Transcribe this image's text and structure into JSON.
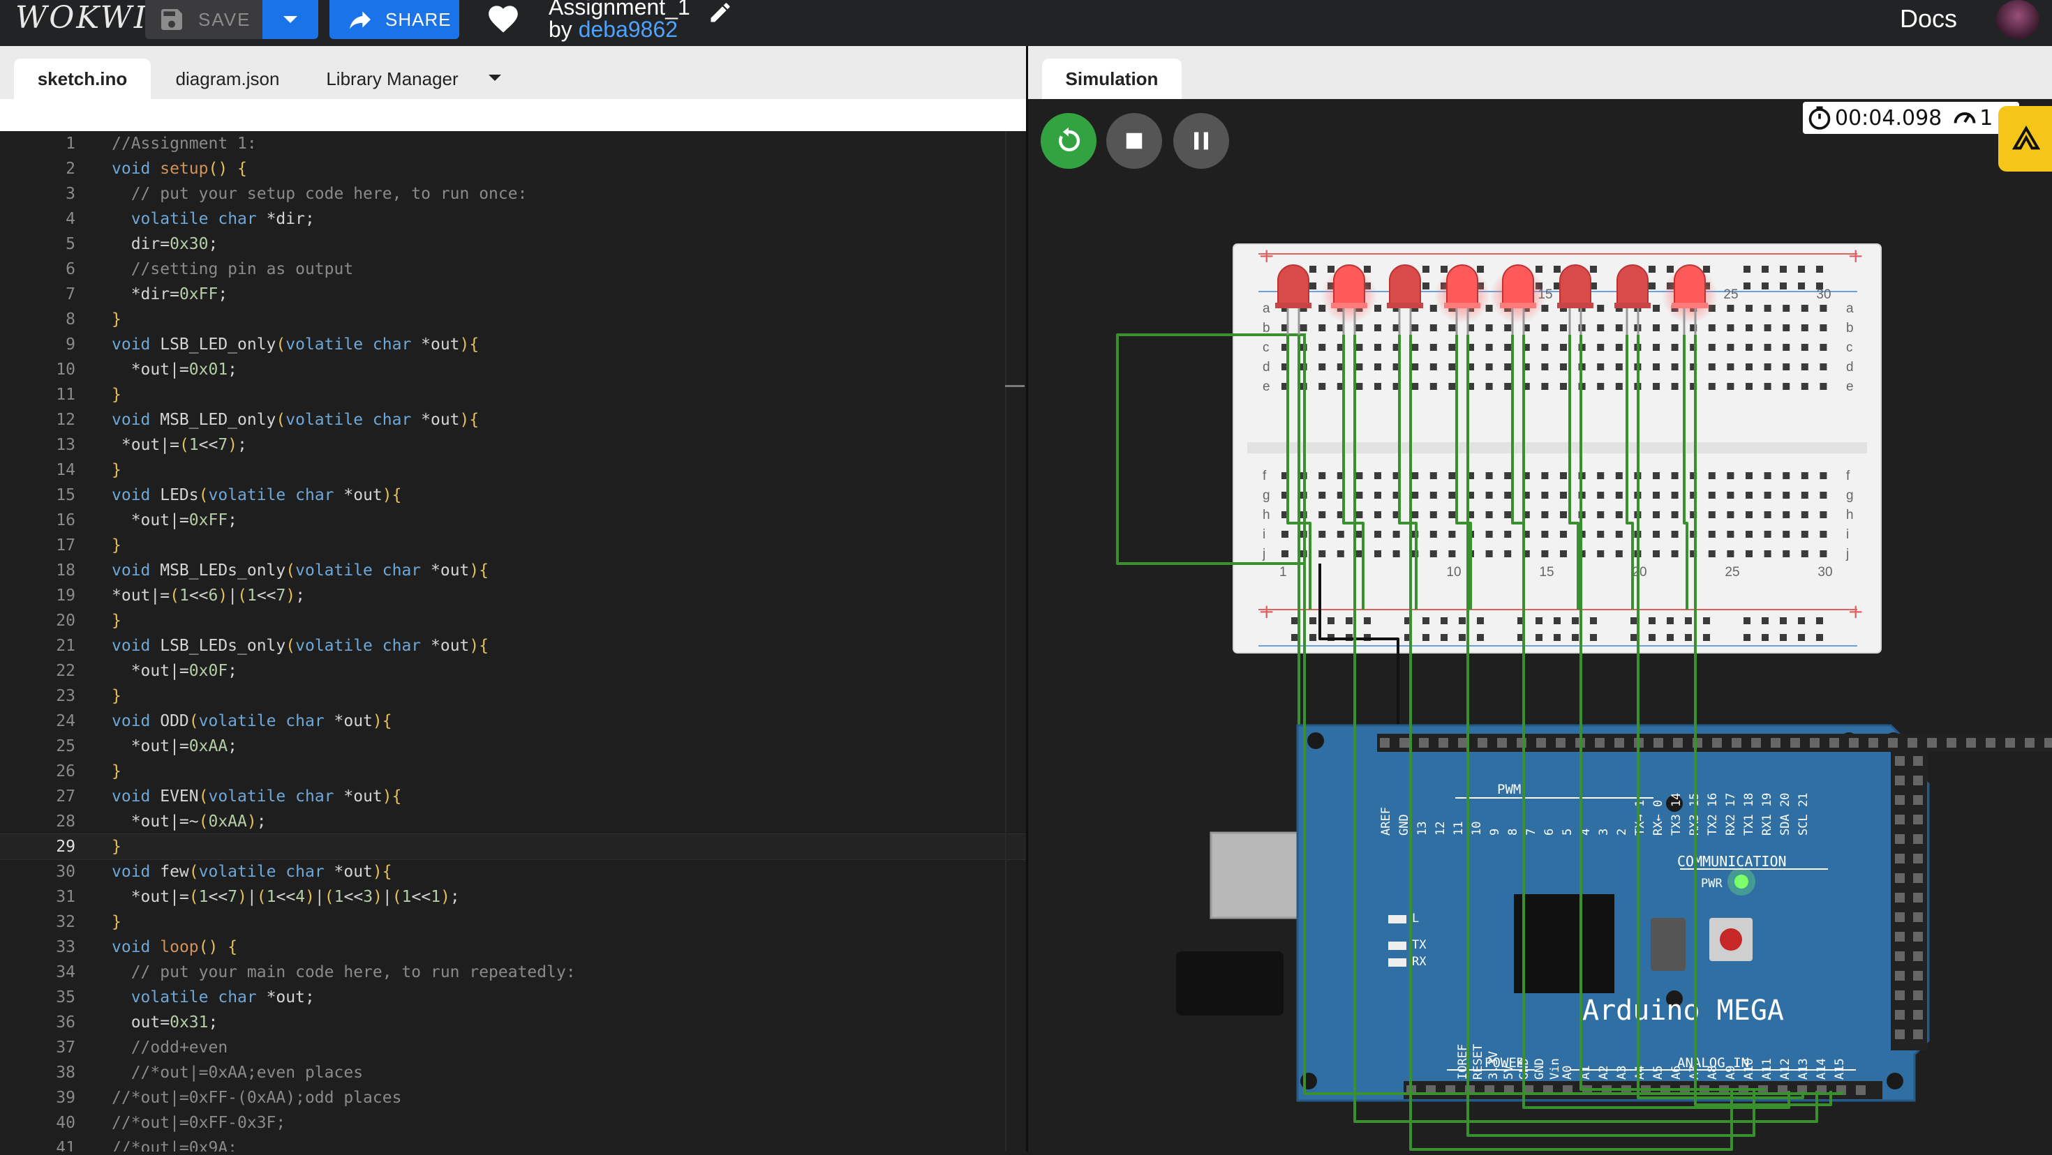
{
  "app": {
    "logo": "WOKWI",
    "docs_label": "Docs"
  },
  "toolbar": {
    "save_label": "SAVE",
    "share_label": "SHARE"
  },
  "project": {
    "title": "Assignment_1",
    "by_prefix": "by ",
    "author": "deba9862"
  },
  "editor": {
    "tabs": [
      "sketch.ino",
      "diagram.json",
      "Library Manager"
    ],
    "active_tab": "sketch.ino",
    "current_line": 29,
    "lines": [
      {
        "n": "1",
        "t": "//Assignment 1:"
      },
      {
        "n": "2",
        "t": "void setup() {"
      },
      {
        "n": "3",
        "t": "  // put your setup code here, to run once:"
      },
      {
        "n": "4",
        "t": "  volatile char *dir;"
      },
      {
        "n": "5",
        "t": "  dir=0x30;"
      },
      {
        "n": "6",
        "t": "  //setting pin as output"
      },
      {
        "n": "7",
        "t": "  *dir=0xFF;"
      },
      {
        "n": "8",
        "t": "}"
      },
      {
        "n": "9",
        "t": "void LSB_LED_only(volatile char *out){"
      },
      {
        "n": "10",
        "t": "  *out|=0x01;"
      },
      {
        "n": "11",
        "t": "}"
      },
      {
        "n": "12",
        "t": "void MSB_LED_only(volatile char *out){"
      },
      {
        "n": "13",
        "t": " *out|=(1<<7);"
      },
      {
        "n": "14",
        "t": "}"
      },
      {
        "n": "15",
        "t": "void LEDs(volatile char *out){"
      },
      {
        "n": "16",
        "t": "  *out|=0xFF;"
      },
      {
        "n": "17",
        "t": "}"
      },
      {
        "n": "18",
        "t": "void MSB_LEDs_only(volatile char *out){"
      },
      {
        "n": "19",
        "t": "*out|=(1<<6)|(1<<7);"
      },
      {
        "n": "20",
        "t": "}"
      },
      {
        "n": "21",
        "t": "void LSB_LEDs_only(volatile char *out){"
      },
      {
        "n": "22",
        "t": "  *out|=0x0F;"
      },
      {
        "n": "23",
        "t": "}"
      },
      {
        "n": "24",
        "t": "void ODD(volatile char *out){"
      },
      {
        "n": "25",
        "t": "  *out|=0xAA;"
      },
      {
        "n": "26",
        "t": "}"
      },
      {
        "n": "27",
        "t": "void EVEN(volatile char *out){"
      },
      {
        "n": "28",
        "t": "  *out|=~(0xAA);"
      },
      {
        "n": "29",
        "t": "}"
      },
      {
        "n": "30",
        "t": "void few(volatile char *out){"
      },
      {
        "n": "31",
        "t": "  *out|=(1<<7)|(1<<4)|(1<<3)|(1<<1);"
      },
      {
        "n": "32",
        "t": "}"
      },
      {
        "n": "33",
        "t": "void loop() {"
      },
      {
        "n": "34",
        "t": "  // put your main code here, to run repeatedly:"
      },
      {
        "n": "35",
        "t": "  volatile char *out;"
      },
      {
        "n": "36",
        "t": "  out=0x31;"
      },
      {
        "n": "37",
        "t": "  //odd+even"
      },
      {
        "n": "38",
        "t": "  //*out|=0xAA;even places"
      },
      {
        "n": "39",
        "t": "//*out|=0xFF-(0xAA);odd places"
      },
      {
        "n": "40",
        "t": "//*out|=0xFF-0x3F;"
      },
      {
        "n": "41",
        "t": "//*out|=0x9A;"
      }
    ]
  },
  "simulation": {
    "tab_label": "Simulation",
    "timer": "00:04.098",
    "speed_partial": "1",
    "breadboard": {
      "top_numbers": [
        "15",
        "0",
        "25",
        "30"
      ],
      "bottom_numbers": [
        "1",
        "10",
        "15",
        "20",
        "25",
        "30"
      ],
      "row_letters_top": [
        "a",
        "b",
        "c",
        "d",
        "e"
      ],
      "row_letters_bottom": [
        "f",
        "g",
        "h",
        "i",
        "j"
      ]
    },
    "leds_lit": [
      false,
      true,
      false,
      true,
      true,
      false,
      false,
      true
    ],
    "arduino": {
      "name": "Arduino MEGA",
      "labels": {
        "pwm": "PWM",
        "communication": "COMMUNICATION",
        "power": "POWER",
        "analog_in": "ANALOG IN",
        "l": "L",
        "tx": "TX",
        "rx": "RX",
        "pwr": "PWR"
      },
      "top_pins": [
        "AREF",
        "GND",
        "13",
        "12",
        "11",
        "10",
        "9",
        "8",
        "7",
        "6",
        "5",
        "4",
        "3",
        "2",
        "TX→ 1",
        "RX← 0",
        "TX3 14",
        "RX3 15",
        "TX2 16",
        "RX2 17",
        "TX1 18",
        "RX1 19",
        "SDA 20",
        "SCL 21"
      ],
      "power_pins": [
        "IOREF",
        "RESET",
        "3.3V",
        "5V",
        "GND",
        "GND",
        "Vin"
      ],
      "analog_pins": [
        "A0",
        "A1",
        "A2",
        "A3",
        "A4",
        "A5",
        "A6",
        "A7",
        "A8",
        "A9",
        "A10",
        "A11",
        "A12",
        "A13",
        "A14",
        "A15"
      ]
    },
    "colors": {
      "wire": "#3a8f2e",
      "board": "#2f6fa4",
      "led_on": "#ff5a5a",
      "led_off": "#d94b4b"
    }
  }
}
